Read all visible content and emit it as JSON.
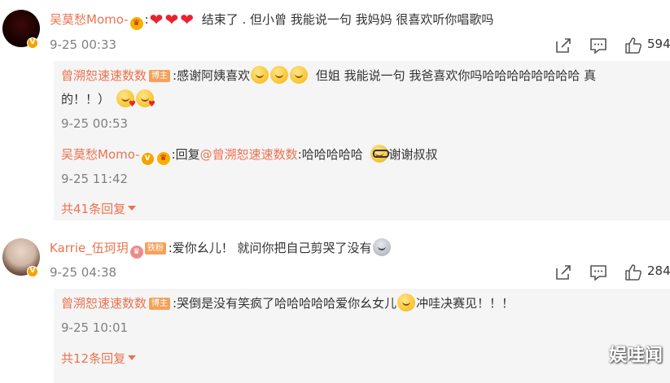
{
  "comments": [
    {
      "user": "吴莫愁Momo-",
      "colon": ":",
      "text": "结束了 . 但小曾 我能说一句 我妈妈 很喜欢听你唱歌吗",
      "time": "9-25 00:33",
      "likes": "594",
      "replies": [
        {
          "user": "曾溯恕速速数数",
          "tag": "博主",
          "text1": ":感谢阿姨喜欢",
          "text2": "但姐 我能说一句 我爸喜欢你吗哈哈哈哈哈哈哈哈 真",
          "text3": "的！！）",
          "time": "9-25 00:53"
        },
        {
          "user": "吴莫愁Momo-",
          "reply_prefix": ":回复",
          "mention": "@曾溯恕速速数数",
          "text1": ":哈哈哈哈哈",
          "text2": "谢谢叔叔",
          "time": "9-25 11:42"
        }
      ],
      "more": "共41条回复"
    },
    {
      "user": "Karrie_伍珂玥",
      "badge": "铁粉",
      "text": ":爱你幺儿！ 就问你把自己剪哭了没有",
      "time": "9-25 04:38",
      "likes": "284",
      "replies": [
        {
          "user": "曾溯恕速速数数",
          "tag": "博主",
          "text1": ":哭倒是没有笑疯了哈哈哈哈哈爱你幺女儿",
          "text2": "冲哇决赛见！！！",
          "time": "9-25 10:01"
        }
      ],
      "more": "共12条回复"
    }
  ],
  "watermark": "娱哇闻",
  "icons": {
    "share": "share-icon",
    "comment": "comment-icon",
    "like": "like-icon",
    "verified": "verified-badge-icon",
    "crown": "crown-badge-icon",
    "heart": "heart-emoji-icon",
    "emoji": "emoji-icon",
    "caret": "caret-down-icon"
  },
  "colors": {
    "username": "#eb7350",
    "text": "#333333",
    "time": "#808080",
    "reply_bg": "#f5f5f5",
    "blogger_tag": "#f6a15a",
    "verified": "#f2a400"
  }
}
